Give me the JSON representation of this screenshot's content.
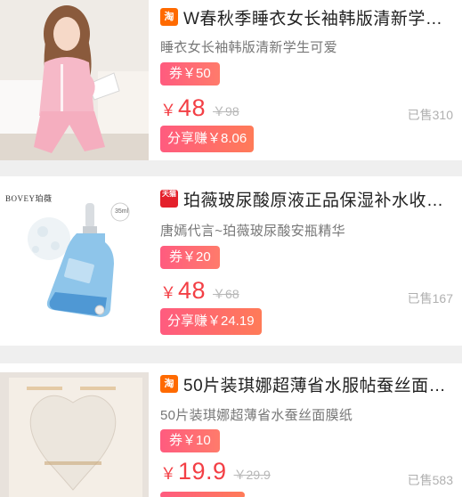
{
  "products": [
    {
      "platform": "淘",
      "title": "W春秋季睡衣女长袖韩版清新学…",
      "subtitle": "睡衣女长袖韩版清新学生可爱",
      "coupon": "券￥50",
      "price_symbol": "￥",
      "price": "48",
      "original_price": "￥98",
      "sold": "已售310",
      "share": "分享赚￥8.06"
    },
    {
      "platform": "天猫",
      "title": "珀薇玻尿酸原液正品保湿补水收…",
      "subtitle": "唐嫣代言~珀薇玻尿酸安瓶精华",
      "coupon": "券￥20",
      "price_symbol": "￥",
      "price": "48",
      "original_price": "￥68",
      "sold": "已售167",
      "share": "分享赚￥24.19",
      "brand_text": "BOVEY珀薇",
      "bottle_tag": "35ml"
    },
    {
      "platform": "淘",
      "title": "50片装琪娜超薄省水服帖蚕丝面…",
      "subtitle": "50片装琪娜超薄省水蚕丝面膜纸",
      "coupon": "券￥10",
      "price_symbol": "￥",
      "price": "19.9",
      "original_price": "￥29.9",
      "sold": "已售583"
    }
  ],
  "colors": {
    "price_red": "#f33f45",
    "coupon_pink": "#ff5b7f",
    "taobao_orange": "#ff6a00",
    "tmall_red": "#e4202b"
  }
}
